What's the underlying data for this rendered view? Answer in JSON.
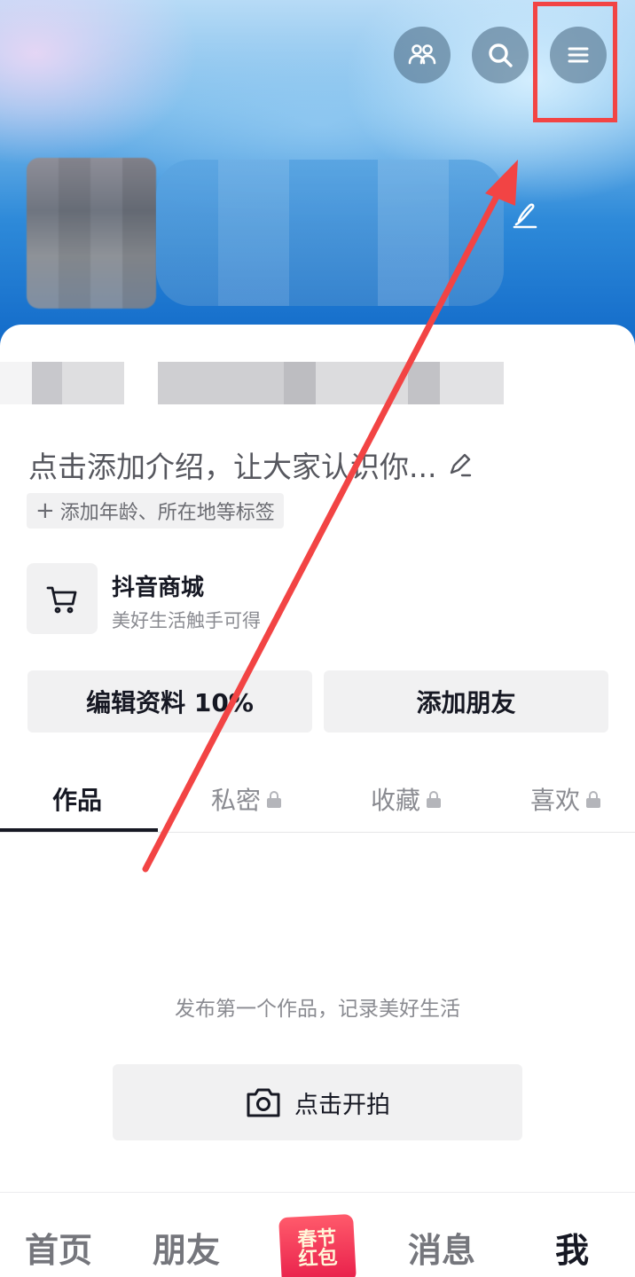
{
  "intro": {
    "placeholder": "点击添加介绍，让大家认识你...",
    "tag_chip": "添加年龄、所在地等标签"
  },
  "shop": {
    "title": "抖音商城",
    "subtitle": "美好生活触手可得"
  },
  "actions": {
    "edit_profile": "编辑资料 10%",
    "add_friends": "添加朋友"
  },
  "tabs": [
    {
      "label": "作品",
      "locked": false,
      "active": true
    },
    {
      "label": "私密",
      "locked": true,
      "active": false
    },
    {
      "label": "收藏",
      "locked": true,
      "active": false
    },
    {
      "label": "喜欢",
      "locked": true,
      "active": false
    }
  ],
  "empty_state": {
    "text": "发布第一个作品，记录美好生活",
    "button": "点击开拍"
  },
  "bottom_nav": [
    {
      "label": "首页",
      "active": false
    },
    {
      "label": "朋友",
      "active": false
    },
    {
      "label": "春节红包",
      "active": false
    },
    {
      "label": "消息",
      "active": false
    },
    {
      "label": "我",
      "active": true
    }
  ],
  "icons": {
    "friends": "friends-icon",
    "search": "search-icon",
    "menu": "menu-icon",
    "edit": "pencil-icon",
    "cart": "cart-icon",
    "lock": "lock-icon",
    "camera": "camera-icon"
  },
  "colors": {
    "annotation": "#f24444",
    "banner_bottom": "#1068c8",
    "text_primary": "#161823",
    "text_secondary": "#8a8b91"
  }
}
